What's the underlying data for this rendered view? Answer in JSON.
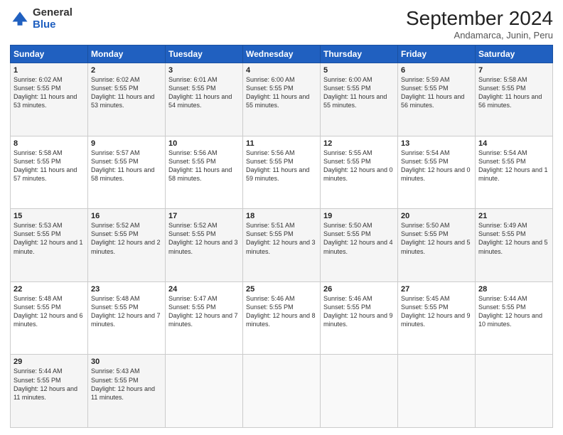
{
  "logo": {
    "general": "General",
    "blue": "Blue"
  },
  "title": "September 2024",
  "location": "Andamarca, Junin, Peru",
  "weekdays": [
    "Sunday",
    "Monday",
    "Tuesday",
    "Wednesday",
    "Thursday",
    "Friday",
    "Saturday"
  ],
  "weeks": [
    [
      {
        "day": "1",
        "sunrise": "6:02 AM",
        "sunset": "5:55 PM",
        "daylight": "11 hours and 53 minutes."
      },
      {
        "day": "2",
        "sunrise": "6:02 AM",
        "sunset": "5:55 PM",
        "daylight": "11 hours and 53 minutes."
      },
      {
        "day": "3",
        "sunrise": "6:01 AM",
        "sunset": "5:55 PM",
        "daylight": "11 hours and 54 minutes."
      },
      {
        "day": "4",
        "sunrise": "6:00 AM",
        "sunset": "5:55 PM",
        "daylight": "11 hours and 55 minutes."
      },
      {
        "day": "5",
        "sunrise": "6:00 AM",
        "sunset": "5:55 PM",
        "daylight": "11 hours and 55 minutes."
      },
      {
        "day": "6",
        "sunrise": "5:59 AM",
        "sunset": "5:55 PM",
        "daylight": "11 hours and 56 minutes."
      },
      {
        "day": "7",
        "sunrise": "5:58 AM",
        "sunset": "5:55 PM",
        "daylight": "11 hours and 56 minutes."
      }
    ],
    [
      {
        "day": "8",
        "sunrise": "5:58 AM",
        "sunset": "5:55 PM",
        "daylight": "11 hours and 57 minutes."
      },
      {
        "day": "9",
        "sunrise": "5:57 AM",
        "sunset": "5:55 PM",
        "daylight": "11 hours and 58 minutes."
      },
      {
        "day": "10",
        "sunrise": "5:56 AM",
        "sunset": "5:55 PM",
        "daylight": "11 hours and 58 minutes."
      },
      {
        "day": "11",
        "sunrise": "5:56 AM",
        "sunset": "5:55 PM",
        "daylight": "11 hours and 59 minutes."
      },
      {
        "day": "12",
        "sunrise": "5:55 AM",
        "sunset": "5:55 PM",
        "daylight": "12 hours and 0 minutes."
      },
      {
        "day": "13",
        "sunrise": "5:54 AM",
        "sunset": "5:55 PM",
        "daylight": "12 hours and 0 minutes."
      },
      {
        "day": "14",
        "sunrise": "5:54 AM",
        "sunset": "5:55 PM",
        "daylight": "12 hours and 1 minute."
      }
    ],
    [
      {
        "day": "15",
        "sunrise": "5:53 AM",
        "sunset": "5:55 PM",
        "daylight": "12 hours and 1 minute."
      },
      {
        "day": "16",
        "sunrise": "5:52 AM",
        "sunset": "5:55 PM",
        "daylight": "12 hours and 2 minutes."
      },
      {
        "day": "17",
        "sunrise": "5:52 AM",
        "sunset": "5:55 PM",
        "daylight": "12 hours and 3 minutes."
      },
      {
        "day": "18",
        "sunrise": "5:51 AM",
        "sunset": "5:55 PM",
        "daylight": "12 hours and 3 minutes."
      },
      {
        "day": "19",
        "sunrise": "5:50 AM",
        "sunset": "5:55 PM",
        "daylight": "12 hours and 4 minutes."
      },
      {
        "day": "20",
        "sunrise": "5:50 AM",
        "sunset": "5:55 PM",
        "daylight": "12 hours and 5 minutes."
      },
      {
        "day": "21",
        "sunrise": "5:49 AM",
        "sunset": "5:55 PM",
        "daylight": "12 hours and 5 minutes."
      }
    ],
    [
      {
        "day": "22",
        "sunrise": "5:48 AM",
        "sunset": "5:55 PM",
        "daylight": "12 hours and 6 minutes."
      },
      {
        "day": "23",
        "sunrise": "5:48 AM",
        "sunset": "5:55 PM",
        "daylight": "12 hours and 7 minutes."
      },
      {
        "day": "24",
        "sunrise": "5:47 AM",
        "sunset": "5:55 PM",
        "daylight": "12 hours and 7 minutes."
      },
      {
        "day": "25",
        "sunrise": "5:46 AM",
        "sunset": "5:55 PM",
        "daylight": "12 hours and 8 minutes."
      },
      {
        "day": "26",
        "sunrise": "5:46 AM",
        "sunset": "5:55 PM",
        "daylight": "12 hours and 9 minutes."
      },
      {
        "day": "27",
        "sunrise": "5:45 AM",
        "sunset": "5:55 PM",
        "daylight": "12 hours and 9 minutes."
      },
      {
        "day": "28",
        "sunrise": "5:44 AM",
        "sunset": "5:55 PM",
        "daylight": "12 hours and 10 minutes."
      }
    ],
    [
      {
        "day": "29",
        "sunrise": "5:44 AM",
        "sunset": "5:55 PM",
        "daylight": "12 hours and 11 minutes."
      },
      {
        "day": "30",
        "sunrise": "5:43 AM",
        "sunset": "5:55 PM",
        "daylight": "12 hours and 11 minutes."
      },
      null,
      null,
      null,
      null,
      null
    ]
  ]
}
